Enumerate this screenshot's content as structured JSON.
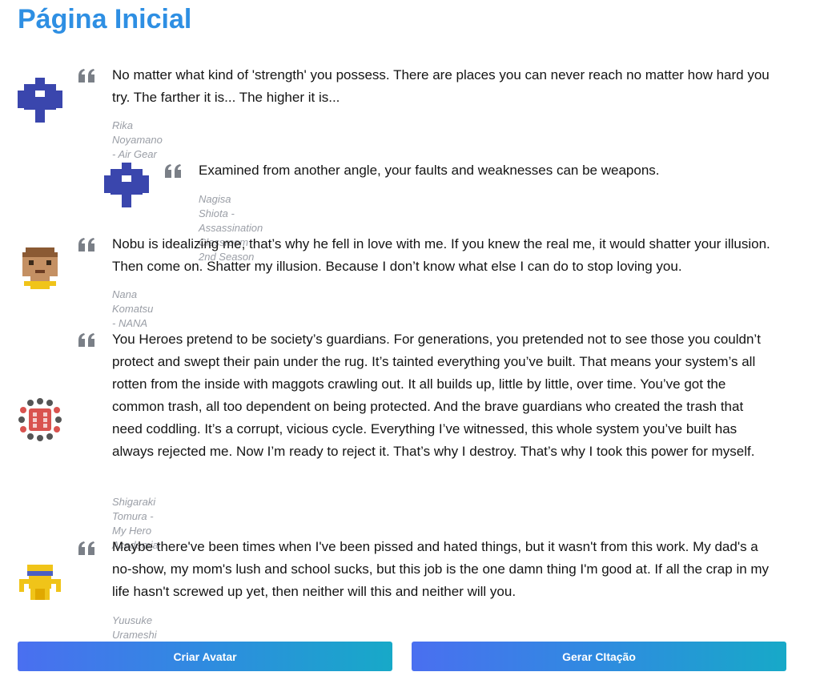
{
  "page": {
    "title": "Página Inicial"
  },
  "quotes": [
    {
      "text": "No matter what kind of 'strength' you possess. There are places you can never reach no matter how hard you try. The farther it is... The higher it is...",
      "author": "Rika Noyamano - Air Gear",
      "avatar_icon": "blue-cross-avatar-icon"
    },
    {
      "text": "Examined from another angle, your faults and weaknesses can be weapons.",
      "author": "Nagisa Shiota - Assassination Classroom 2nd Season",
      "avatar_icon": "blue-cross-avatar-icon"
    },
    {
      "text": "Nobu is idealizing me, that’s why he fell in love with me. If you knew the real me, it would shatter your illusion. Then come on. Shatter my illusion. Because I don’t know what else I can do to stop loving you.",
      "author": "Nana Komatsu - NANA",
      "avatar_icon": "face-avatar-icon"
    },
    {
      "text": "You Heroes pretend to be society’s guardians. For generations, you pretended not to see those you couldn’t protect and swept their pain under the rug. It’s tainted everything you’ve built. That means your system’s all rotten from the inside with maggots crawling out. It all builds up, little by little, over time. You’ve got the common trash, all too dependent on being protected. And the brave guardians who created the trash that need coddling. It’s a corrupt, vicious cycle. Everything I’ve witnessed, this whole system you’ve built has always rejected me. Now I’m ready to reject it. That’s why I destroy. That’s why I took this power for myself.",
      "author": "Shigaraki Tomura - My Hero Academia",
      "avatar_icon": "dotted-circle-avatar-icon"
    },
    {
      "text": "Maybe there've been times when I've been pissed and hated things, but it wasn't from this work. My dad's a no-show, my mom's lush and school sucks, but this job is the one damn thing I'm good at. If all the crap in my life hasn't screwed up yet, then neither will this and neither will you.",
      "author": "Yuusuke Urameshi - Yu Yu Hakusho",
      "avatar_icon": "yellow-figure-avatar-icon"
    }
  ],
  "buttons": {
    "create_avatar": "Criar Avatar",
    "generate_quote": "Gerar CItação"
  },
  "colors": {
    "title": "#2e8fe3",
    "quote_mark": "#7a7f87",
    "author": "#9a9ea6",
    "button_gradient_start": "#4a6ff0",
    "button_gradient_end": "#17a9c8"
  }
}
